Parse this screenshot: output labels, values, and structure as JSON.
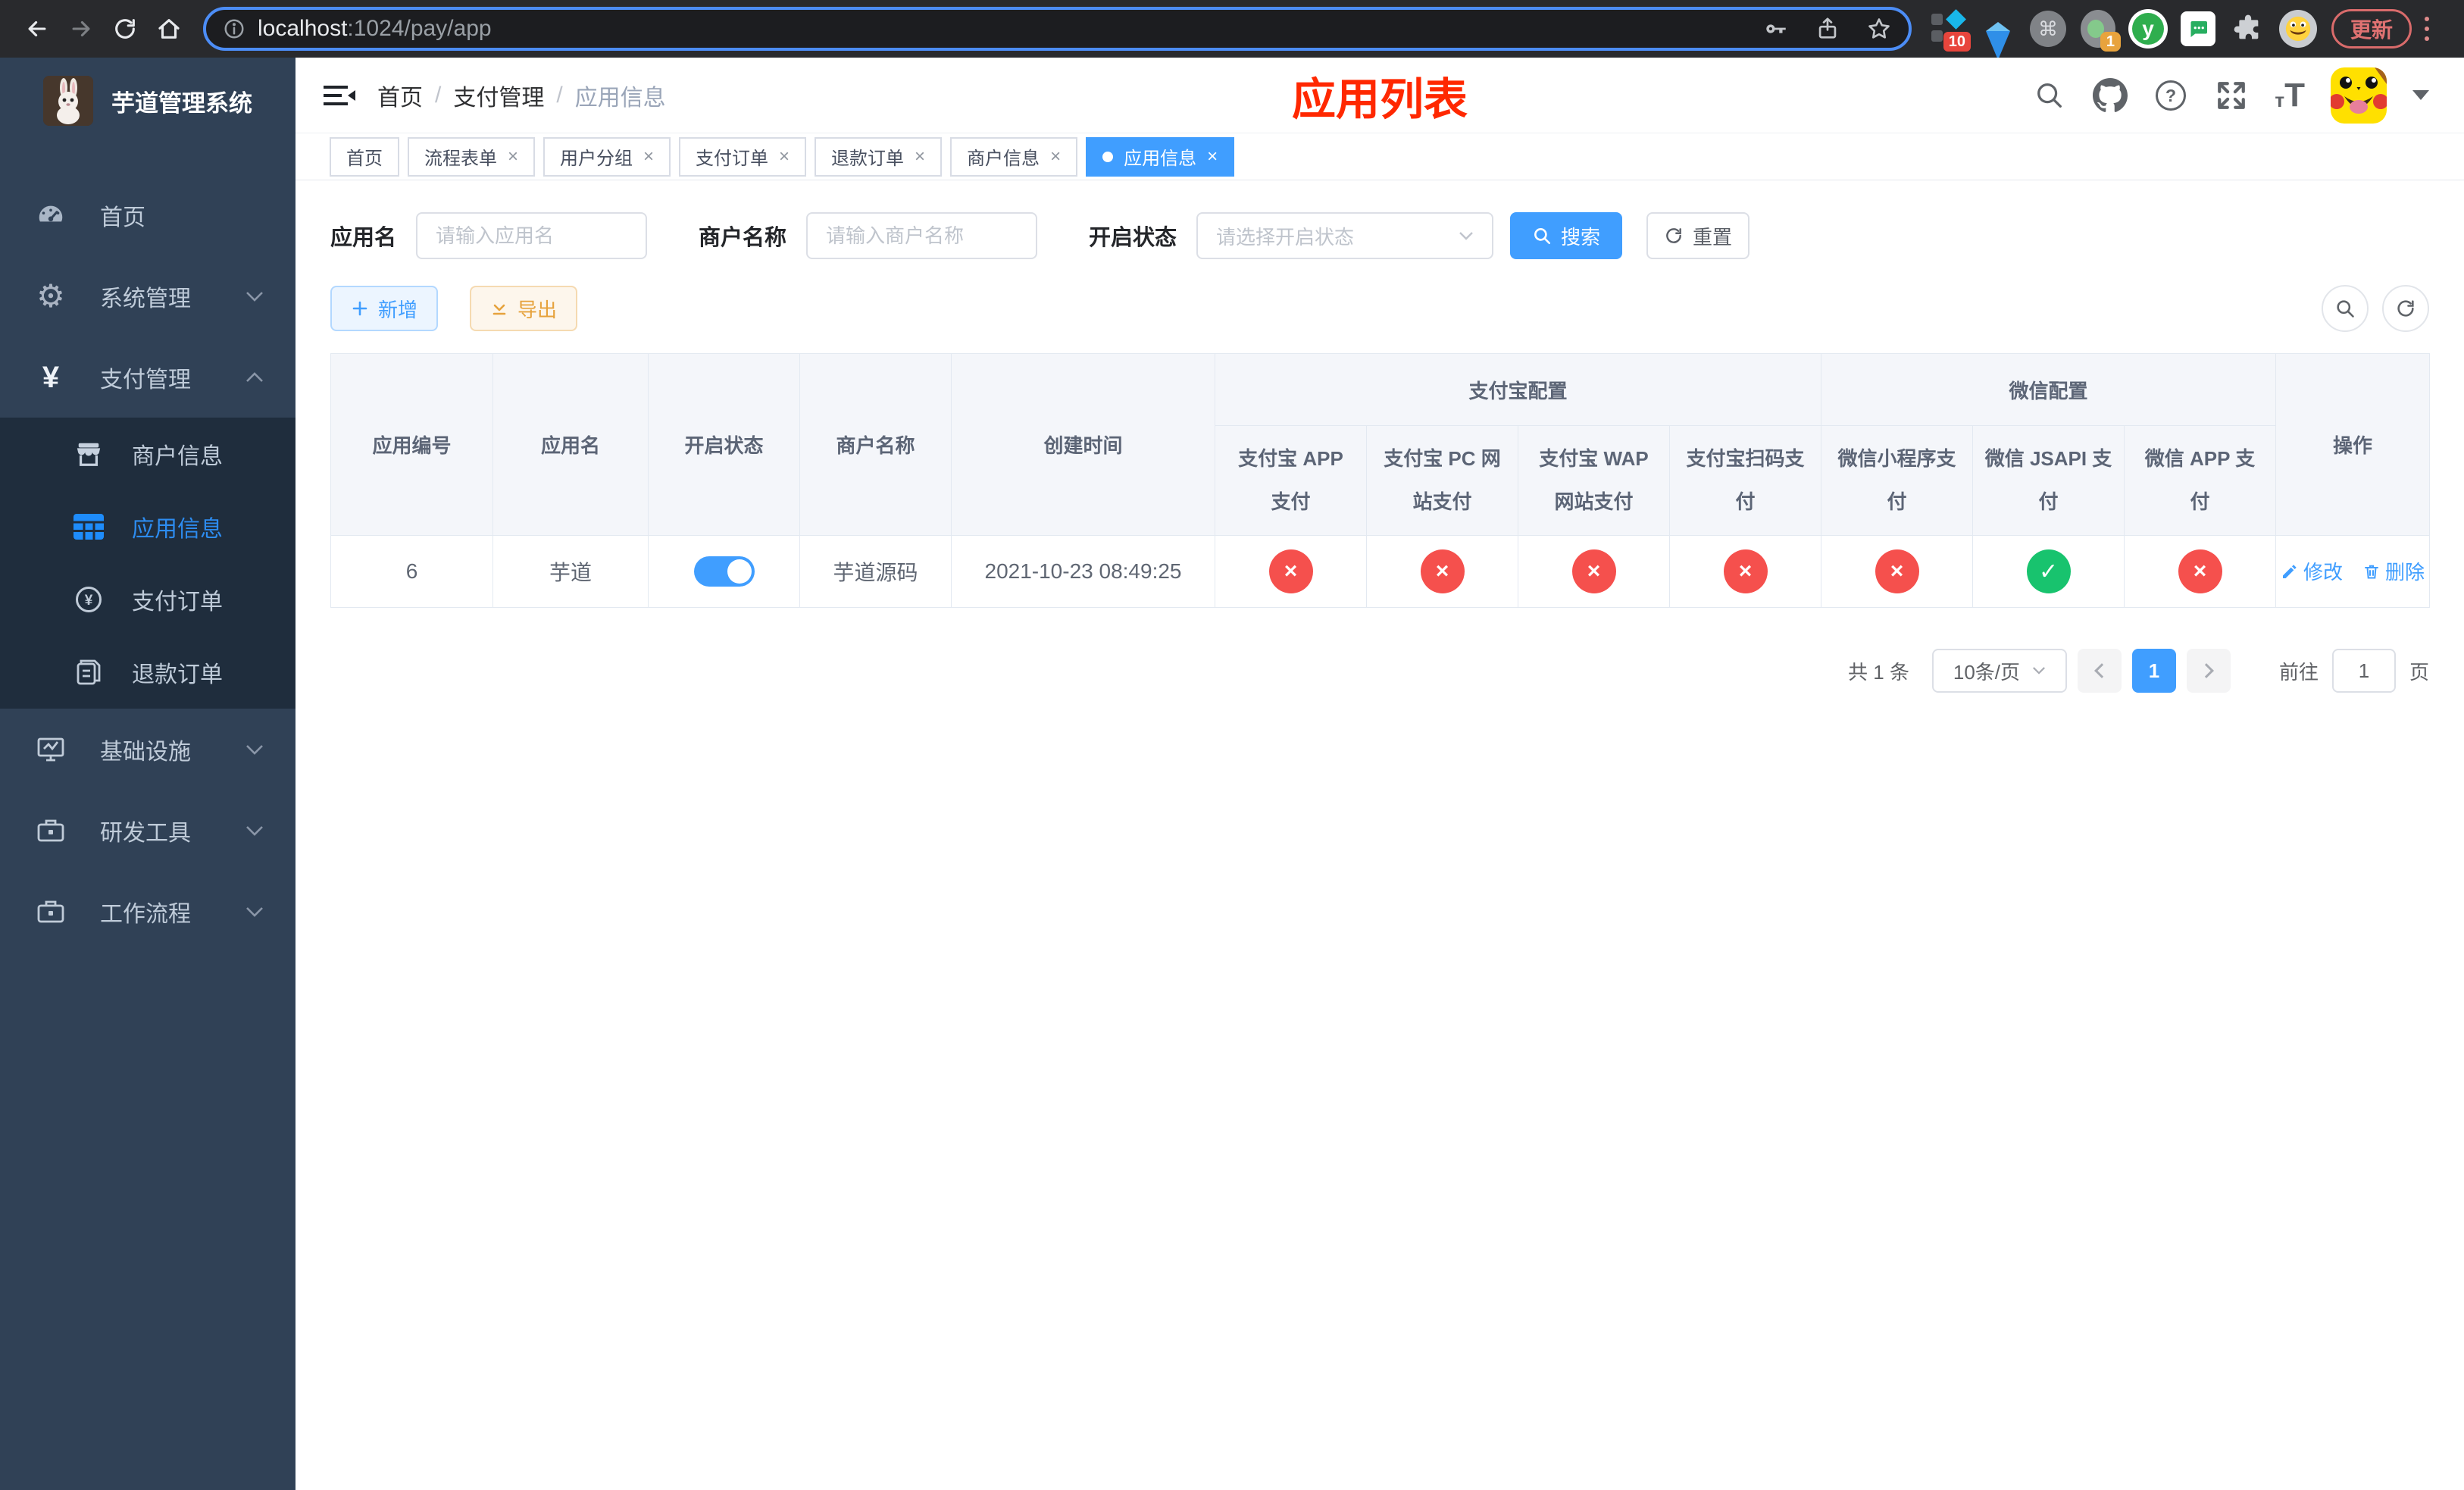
{
  "browser": {
    "url": {
      "host": "localhost",
      "rest": ":1024/pay/app"
    },
    "ext_badge_10": "10",
    "ext_badge_1": "1",
    "update_button": "更新"
  },
  "sidebar": {
    "app_title": "芋道管理系统",
    "menu": [
      {
        "label": "首页"
      },
      {
        "label": "系统管理"
      },
      {
        "label": "支付管理"
      },
      {
        "label": "商户信息"
      },
      {
        "label": "应用信息"
      },
      {
        "label": "支付订单"
      },
      {
        "label": "退款订单"
      },
      {
        "label": "基础设施"
      },
      {
        "label": "研发工具"
      },
      {
        "label": "工作流程"
      }
    ]
  },
  "header": {
    "breadcrumb": [
      "首页",
      "支付管理",
      "应用信息"
    ],
    "annotation": "应用列表",
    "annotation_color": "#ff2800"
  },
  "tabs": [
    {
      "label": "首页"
    },
    {
      "label": "流程表单"
    },
    {
      "label": "用户分组"
    },
    {
      "label": "支付订单"
    },
    {
      "label": "退款订单"
    },
    {
      "label": "商户信息"
    },
    {
      "label": "应用信息"
    }
  ],
  "filters": {
    "app_name": {
      "label": "应用名",
      "placeholder": "请输入应用名",
      "value": ""
    },
    "merchant_name": {
      "label": "商户名称",
      "placeholder": "请输入商户名称",
      "value": ""
    },
    "status": {
      "label": "开启状态",
      "placeholder": "请选择开启状态",
      "value": ""
    },
    "search_button": "搜索",
    "reset_button": "重置"
  },
  "toolbar": {
    "add_button": "新增",
    "export_button": "导出"
  },
  "table": {
    "columns_left": [
      "应用编号",
      "应用名",
      "开启状态",
      "商户名称",
      "创建时间"
    ],
    "groups": [
      {
        "label": "支付宝配置",
        "children": [
          "支付宝 APP 支付",
          "支付宝 PC 网站支付",
          "支付宝 WAP 网站支付",
          "支付宝扫码支付"
        ]
      },
      {
        "label": "微信配置",
        "children": [
          "微信小程序支付",
          "微信 JSAPI 支付",
          "微信 APP 支付"
        ]
      }
    ],
    "column_actions": "操作",
    "row": {
      "id": "6",
      "name": "芋道",
      "status_on": true,
      "merchant": "芋道源码",
      "created_at": "2021-10-23 08:49:25",
      "channels": [
        {
          "name": "支付宝 APP 支付",
          "enabled": false
        },
        {
          "name": "支付宝 PC 网站支付",
          "enabled": false
        },
        {
          "name": "支付宝 WAP 网站支付",
          "enabled": false
        },
        {
          "name": "支付宝扫码支付",
          "enabled": false
        },
        {
          "name": "微信小程序支付",
          "enabled": false
        },
        {
          "name": "微信 JSAPI 支付",
          "enabled": true
        },
        {
          "name": "微信 APP 支付",
          "enabled": false
        }
      ],
      "edit_label": "修改",
      "delete_label": "删除"
    },
    "status_colors": {
      "enabled": "#18c36e",
      "disabled": "#f5504d"
    },
    "accent_color": "#409eff"
  },
  "pagination": {
    "total": "共 1 条",
    "page_size": "10条/页",
    "current_page": "1",
    "goto_prefix": "前往",
    "goto_value": "1",
    "goto_suffix": "页"
  }
}
